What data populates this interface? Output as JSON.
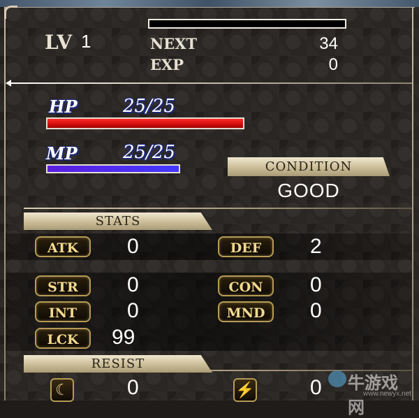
{
  "level": {
    "label": "LV",
    "value": "1"
  },
  "experience": {
    "next_label": "NEXT",
    "next_value": "34",
    "exp_label": "EXP",
    "exp_value": "0",
    "bar_fraction": 0
  },
  "hp": {
    "label": "HP",
    "text": "25/25",
    "current": 25,
    "max": 25
  },
  "mp": {
    "label": "MP",
    "text": "25/25",
    "current": 25,
    "max": 25
  },
  "condition": {
    "label": "CONDITION",
    "value": "GOOD"
  },
  "stats": {
    "header": "STATS",
    "atk": {
      "label": "ATK",
      "value": "0"
    },
    "def": {
      "label": "DEF",
      "value": "2"
    },
    "str": {
      "label": "STR",
      "value": "0"
    },
    "con": {
      "label": "CON",
      "value": "0"
    },
    "int": {
      "label": "INT",
      "value": "0"
    },
    "mnd": {
      "label": "MND",
      "value": "0"
    },
    "lck": {
      "label": "LCK",
      "value": "99"
    }
  },
  "resist": {
    "header": "RESIST",
    "items": [
      {
        "icon": "moon-icon",
        "value": "0"
      },
      {
        "icon": "lightning-icon",
        "value": "0"
      }
    ]
  },
  "watermark": {
    "text": "牛游戏网",
    "url": "www.newyx.net"
  },
  "colors": {
    "hp": "#e01010",
    "mp": "#4a2bf0",
    "badge_border": "#b79b54"
  }
}
